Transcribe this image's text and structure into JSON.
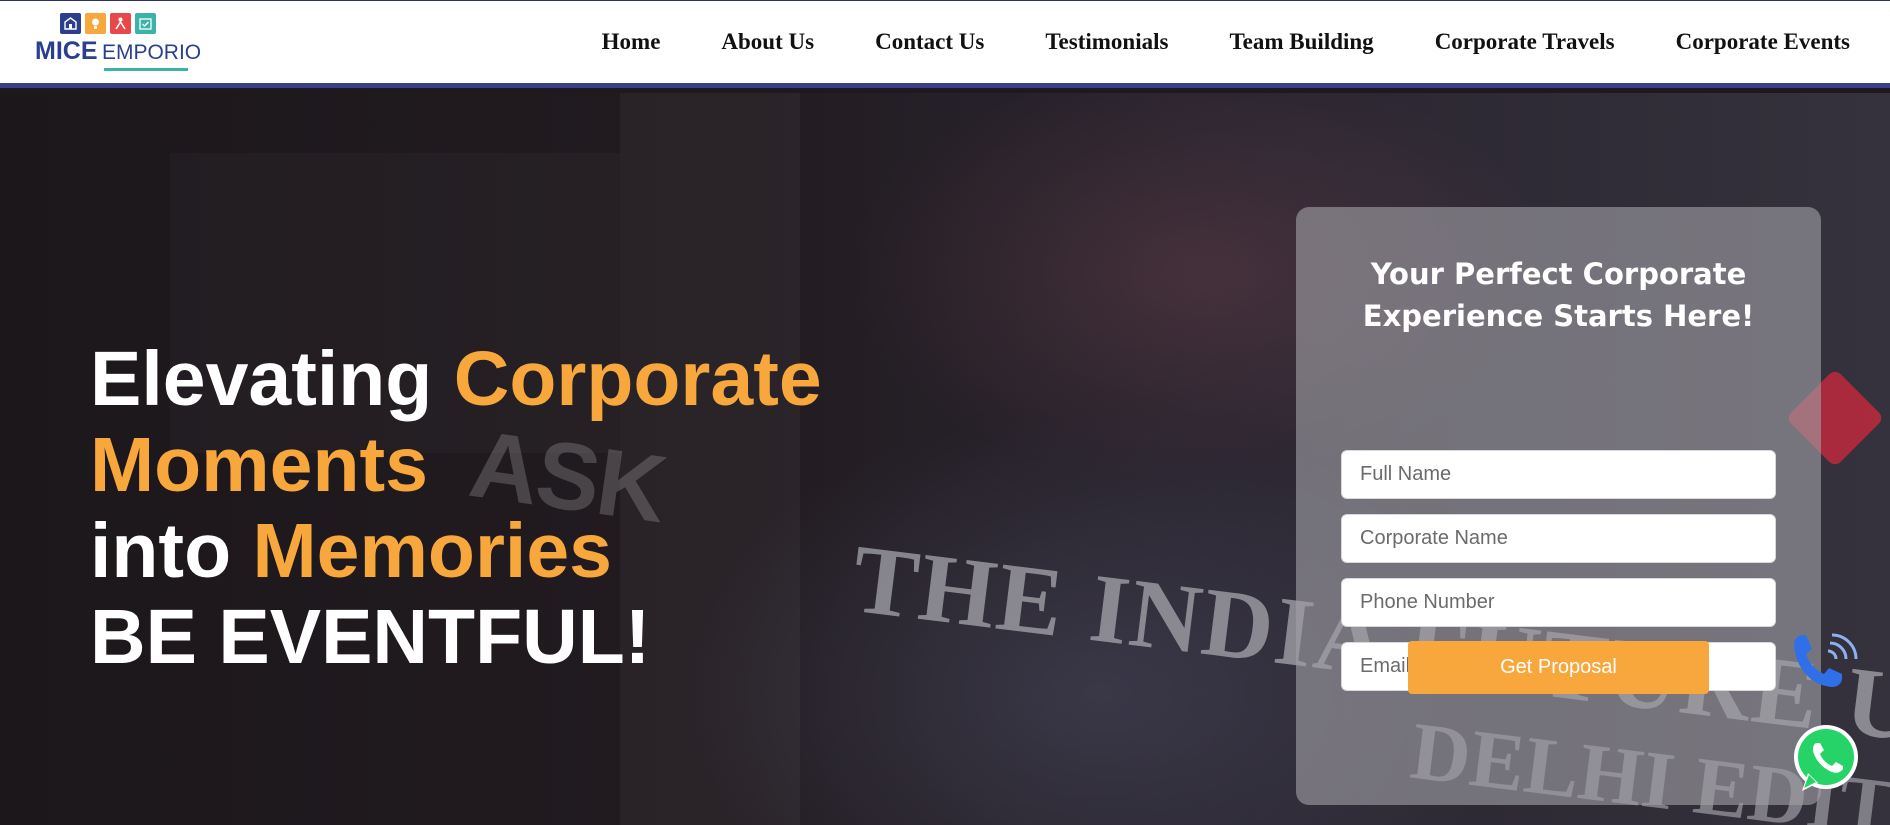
{
  "brand": {
    "name_bold": "MICE",
    "name_light": "EMPORIO",
    "logo_icons": [
      "building-icon",
      "idea-icon",
      "people-icon",
      "calendar-check-icon"
    ],
    "logo_colors": [
      "#2b3f8c",
      "#f7a73b",
      "#e9484b",
      "#3bb3a8"
    ]
  },
  "nav": {
    "items": [
      "Home",
      "About Us",
      "Contact Us",
      "Testimonials",
      "Team Building",
      "Corporate Travels",
      "Corporate Events"
    ]
  },
  "hero": {
    "line1_white": "Elevating ",
    "line1_accent": "Corporate",
    "line2_accent": "Moments",
    "line3_white": "into ",
    "line3_accent": "Memories",
    "line4_white": "BE EVENTFUL!",
    "background_text": {
      "ask": "ASK",
      "banner": "THE INDIA FUTURE UN",
      "city": "DELHI EDIT"
    }
  },
  "form": {
    "title_line1": "Your Perfect Corporate",
    "title_line2": "Experience Starts Here!",
    "fields": {
      "full_name": {
        "placeholder": "Full Name",
        "value": ""
      },
      "corporate_name": {
        "placeholder": "Corporate Name",
        "value": ""
      },
      "phone": {
        "placeholder": "Phone Number",
        "value": ""
      },
      "email": {
        "placeholder": "Email Address",
        "value": ""
      }
    },
    "submit_label": "Get Proposal"
  },
  "floating": {
    "call_icon": "phone-call-icon",
    "whatsapp_icon": "whatsapp-icon"
  },
  "colors": {
    "accent": "#f7a73b",
    "nav_border": "#3a3f8c",
    "whatsapp": "#25d366",
    "call": "#2f6fe8"
  }
}
